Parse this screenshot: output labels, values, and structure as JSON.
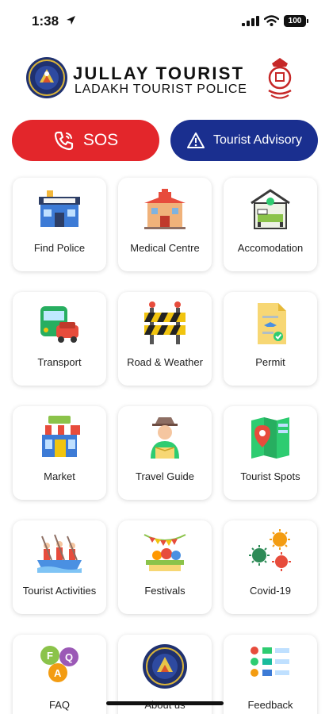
{
  "status": {
    "time": "1:38",
    "battery": "100"
  },
  "header": {
    "title": "JULLAY TOURIST",
    "subtitle": "LADAKH TOURIST POLICE"
  },
  "actions": {
    "sos_label": "SOS",
    "advisory_label": "Tourist Advisory"
  },
  "colors": {
    "sos": "#e3262b",
    "advisory": "#1a2f8f"
  },
  "tiles": [
    {
      "label": "Find Police",
      "icon": "police-station-icon"
    },
    {
      "label": "Medical Centre",
      "icon": "hospital-icon"
    },
    {
      "label": "Accomodation",
      "icon": "bed-icon"
    },
    {
      "label": "Transport",
      "icon": "bus-car-icon"
    },
    {
      "label": "Road & Weather",
      "icon": "road-barrier-icon"
    },
    {
      "label": "Permit",
      "icon": "permit-document-icon"
    },
    {
      "label": "Market",
      "icon": "shop-icon"
    },
    {
      "label": "Travel Guide",
      "icon": "guide-person-icon"
    },
    {
      "label": "Tourist Spots",
      "icon": "map-pin-icon"
    },
    {
      "label": "Tourist Activities",
      "icon": "rafting-icon"
    },
    {
      "label": "Festivals",
      "icon": "festival-icon"
    },
    {
      "label": "Covid-19",
      "icon": "virus-icon"
    },
    {
      "label": "FAQ",
      "icon": "faq-bubbles-icon"
    },
    {
      "label": "About us",
      "icon": "police-logo-icon"
    },
    {
      "label": "Feedback",
      "icon": "feedback-list-icon"
    }
  ]
}
